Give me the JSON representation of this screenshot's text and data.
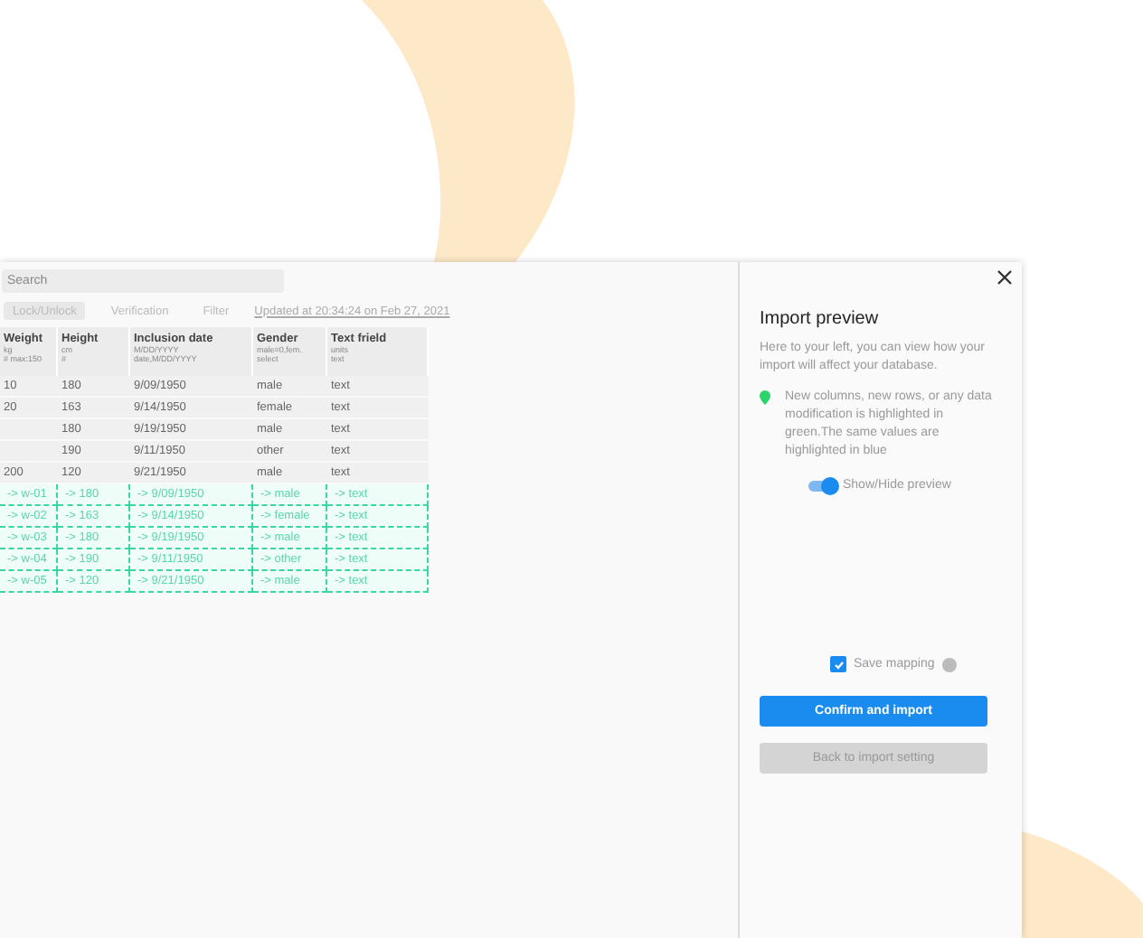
{
  "search": {
    "placeholder": "Search"
  },
  "toolbar": {
    "buttons": [
      {
        "label": "Lock/Unlock",
        "kind": "filled"
      },
      {
        "label": "Verification",
        "kind": "plain"
      },
      {
        "label": "Filter",
        "kind": "plain"
      }
    ],
    "updated_link": "Updated at 20:34:24 on Feb 27, 2021"
  },
  "table": {
    "columns": [
      {
        "title": "Weight",
        "lines": [
          "kg",
          "# max:150"
        ]
      },
      {
        "title": "Height",
        "lines": [
          "cm",
          "#"
        ]
      },
      {
        "title": "Inclusion date",
        "lines": [
          "M/DD/YYYY",
          "date,M/DD/YYYY"
        ]
      },
      {
        "title": "Gender",
        "lines": [
          "male=0,fem.",
          "select"
        ]
      },
      {
        "title": "Text frield",
        "lines": [
          "units",
          "text"
        ]
      }
    ],
    "rows": [
      {
        "kind": "existing",
        "cells": [
          "10",
          "180",
          "9/09/1950",
          "male",
          "text"
        ]
      },
      {
        "kind": "existing",
        "cells": [
          "20",
          "163",
          "9/14/1950",
          "female",
          "text"
        ]
      },
      {
        "kind": "existing",
        "cells": [
          "",
          "180",
          "9/19/1950",
          "male",
          "text"
        ]
      },
      {
        "kind": "existing",
        "cells": [
          "",
          "190",
          "9/11/1950",
          "other",
          "text"
        ]
      },
      {
        "kind": "existing",
        "cells": [
          "200",
          "120",
          "9/21/1950",
          "male",
          "text"
        ]
      },
      {
        "kind": "new",
        "cells": [
          "-> w-01",
          "-> 180",
          "-> 9/09/1950",
          "-> male",
          "-> text"
        ]
      },
      {
        "kind": "new",
        "cells": [
          "-> w-02",
          "-> 163",
          "-> 9/14/1950",
          "-> female",
          "-> text"
        ]
      },
      {
        "kind": "new",
        "cells": [
          "-> w-03",
          "-> 180",
          "-> 9/19/1950",
          "-> male",
          "-> text"
        ]
      },
      {
        "kind": "new",
        "cells": [
          "-> w-04",
          "-> 190",
          "-> 9/11/1950",
          "-> other",
          "-> text"
        ]
      },
      {
        "kind": "new",
        "cells": [
          "-> w-05",
          "-> 120",
          "-> 9/21/1950",
          "-> male",
          "-> text"
        ]
      }
    ]
  },
  "panel": {
    "title": "Import preview",
    "intro": "Here to your left, you can view how your import will affect your database.",
    "note": "New columns, new rows, or any data modification is highlighted in green.The same values are highlighted in blue",
    "toggle": {
      "label": "Show/Hide preview",
      "on": true
    },
    "save_mapping": {
      "label": "Save mapping",
      "checked": true
    },
    "buttons": [
      {
        "label": "Confirm and import",
        "kind": "primary"
      },
      {
        "label": "Back to import setting",
        "kind": "secondary"
      }
    ]
  }
}
